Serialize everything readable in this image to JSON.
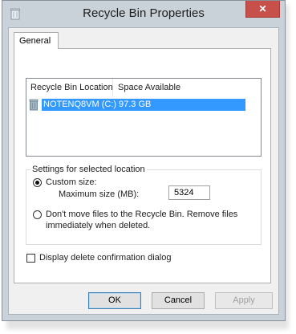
{
  "window": {
    "title": "Recycle Bin Properties",
    "close_glyph": "✕"
  },
  "tabs": [
    {
      "label": "General"
    }
  ],
  "list": {
    "columns": [
      "Recycle Bin Location",
      "Space Available"
    ],
    "rows": [
      {
        "location": "NOTENQ8VM (C:)",
        "space": "97.3 GB",
        "selected": true
      }
    ]
  },
  "settings": {
    "group_title": "Settings for selected location",
    "custom_size_label": "Custom size:",
    "max_size_label": "Maximum size (MB):",
    "max_size_value": "5324",
    "dont_move_label_line1": "Don't move files to the Recycle Bin. Remove files",
    "dont_move_label_line2": "immediately when deleted.",
    "custom_size_selected": true
  },
  "confirm_dialog": {
    "label": "Display delete confirmation dialog",
    "checked": false
  },
  "buttons": {
    "ok": "OK",
    "cancel": "Cancel",
    "apply": "Apply"
  },
  "colors": {
    "selection": "#3399ff",
    "close_button": "#c7504b"
  }
}
